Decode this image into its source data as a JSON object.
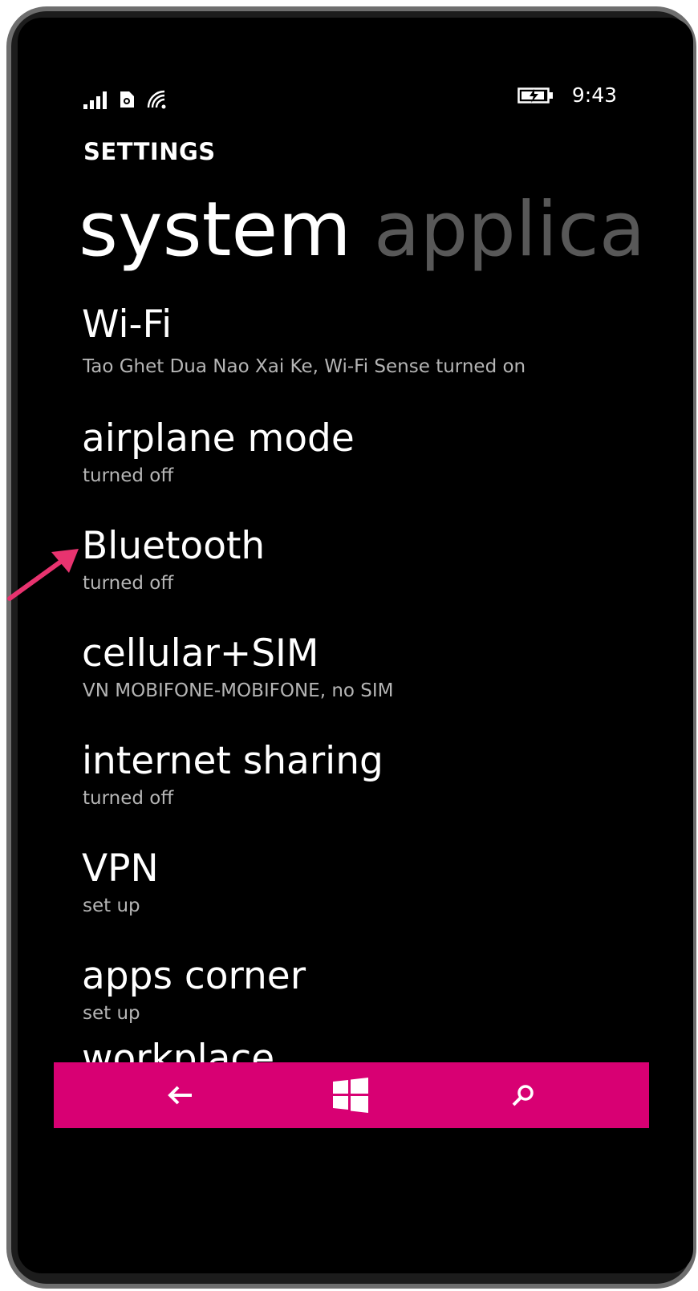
{
  "status_bar": {
    "time": "9:43",
    "icons": [
      "signal-icon",
      "sim-icon",
      "wifi-icon",
      "battery-charging-icon"
    ]
  },
  "header": {
    "app_title": "SETTINGS",
    "pivot_active": "system",
    "pivot_next": "applica"
  },
  "items": [
    {
      "title": "Wi-Fi",
      "subtitle": "Tao Ghet Dua Nao Xai Ke, Wi-Fi Sense turned on"
    },
    {
      "title": "airplane mode",
      "subtitle": "turned off"
    },
    {
      "title": "Bluetooth",
      "subtitle": "turned off"
    },
    {
      "title": "cellular+SIM",
      "subtitle": "VN MOBIFONE-MOBIFONE, no SIM"
    },
    {
      "title": "internet sharing",
      "subtitle": "turned off"
    },
    {
      "title": "VPN",
      "subtitle": "set up"
    },
    {
      "title": "apps corner",
      "subtitle": "set up"
    }
  ],
  "partial_item": "workplace",
  "app_bar": {
    "color": "#d80073",
    "buttons": [
      "back-arrow-icon",
      "windows-start-icon",
      "search-icon"
    ]
  },
  "annotation": {
    "arrow_color": "#e8336f"
  }
}
